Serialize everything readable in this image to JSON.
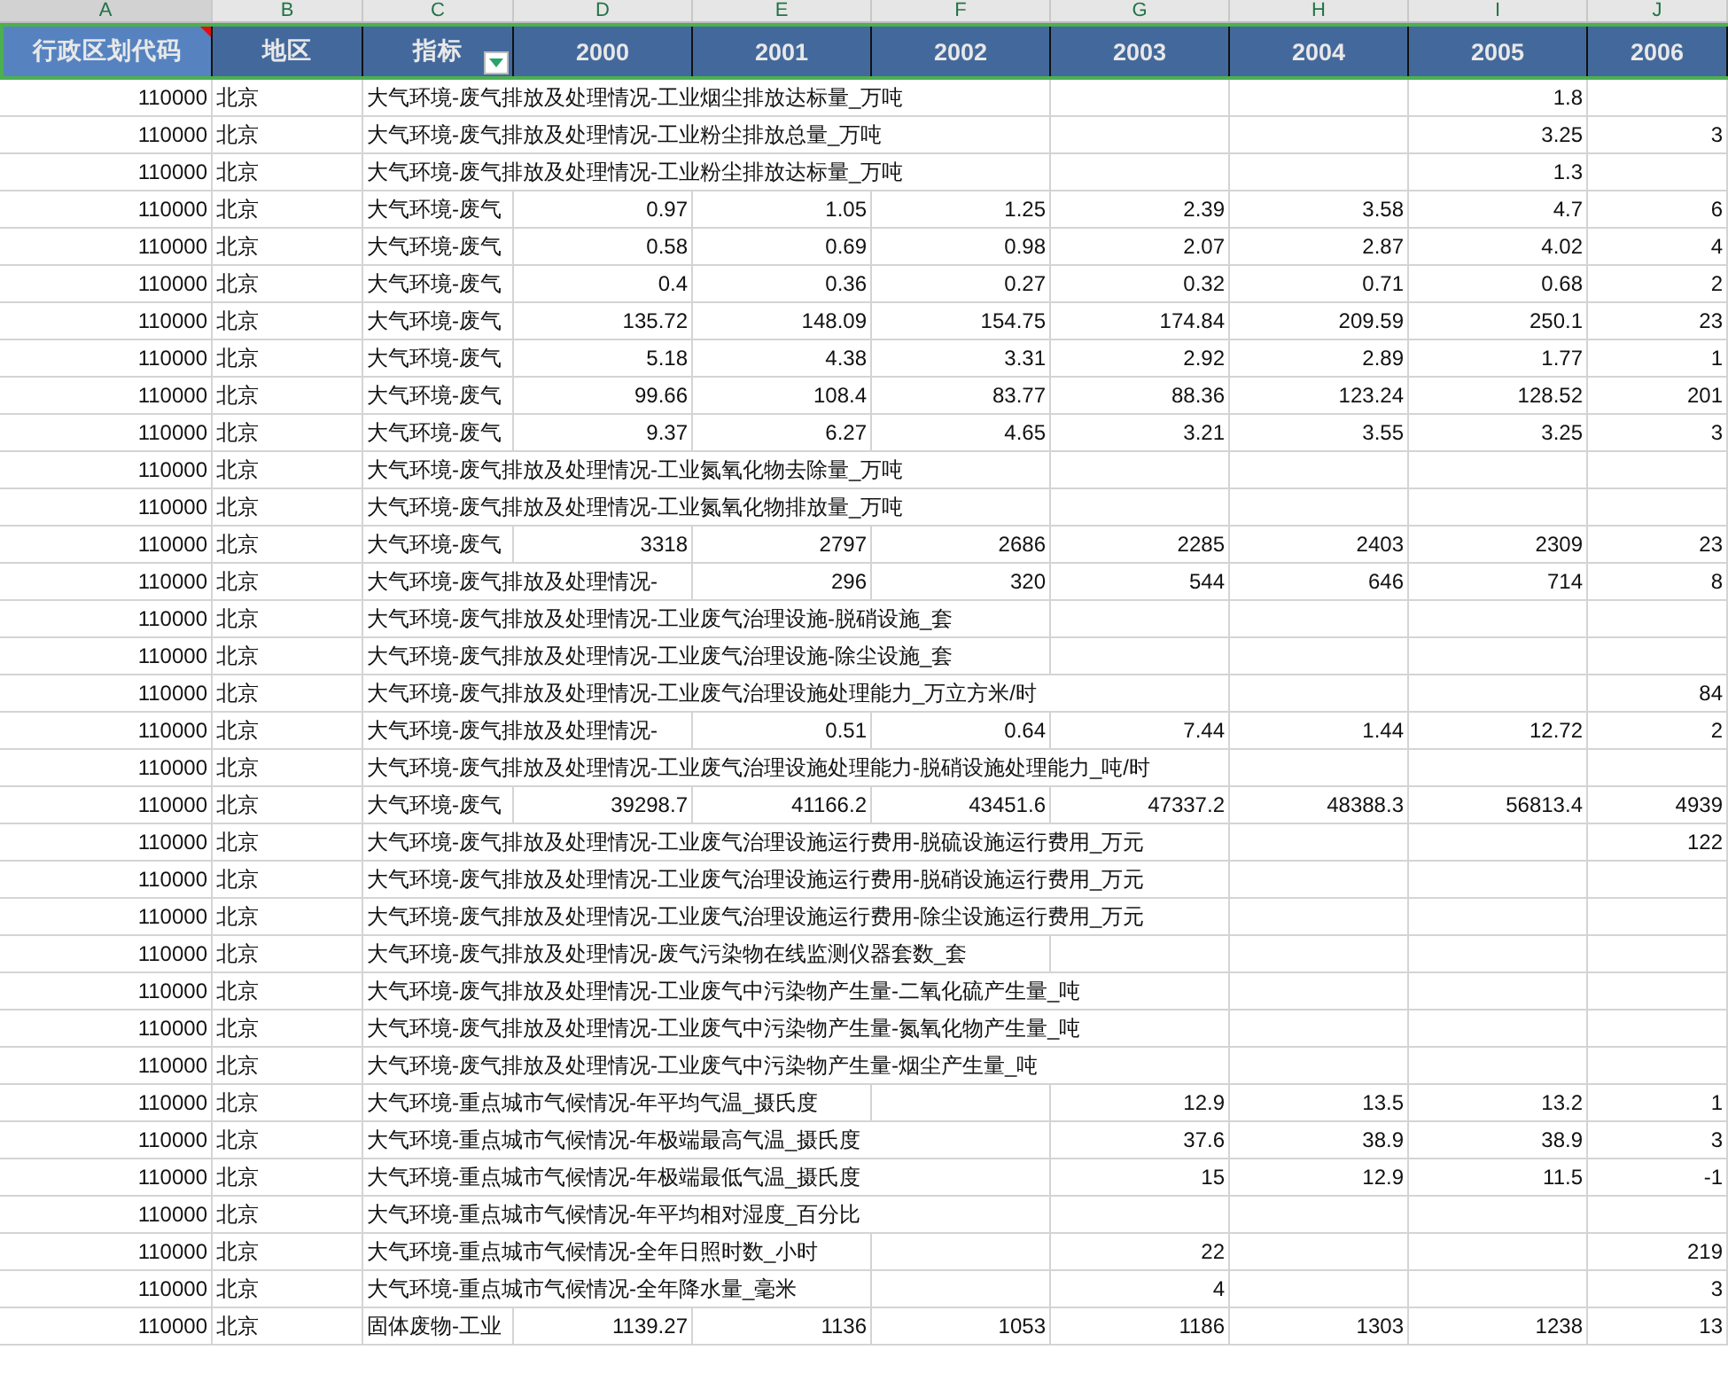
{
  "columns": [
    {
      "letter": "A",
      "heading": "行政区划代码",
      "selected": true,
      "filter": false,
      "comment": true
    },
    {
      "letter": "B",
      "heading": "地区",
      "selected": false,
      "filter": false,
      "comment": false
    },
    {
      "letter": "C",
      "heading": "指标",
      "selected": false,
      "filter": true,
      "comment": false
    },
    {
      "letter": "D",
      "heading": "2000",
      "selected": false,
      "filter": false,
      "comment": false
    },
    {
      "letter": "E",
      "heading": "2001",
      "selected": false,
      "filter": false,
      "comment": false
    },
    {
      "letter": "F",
      "heading": "2002",
      "selected": false,
      "filter": false,
      "comment": false
    },
    {
      "letter": "G",
      "heading": "2003",
      "selected": false,
      "filter": false,
      "comment": false
    },
    {
      "letter": "H",
      "heading": "2004",
      "selected": false,
      "filter": false,
      "comment": false
    },
    {
      "letter": "I",
      "heading": "2005",
      "selected": false,
      "filter": false,
      "comment": false
    },
    {
      "letter": "J",
      "heading": "2006",
      "selected": false,
      "filter": false,
      "comment": false
    }
  ],
  "rows": [
    {
      "code": "110000",
      "region": "北京",
      "indicator": "大气环境-废气排放及处理情况-工业烟尘排放达标量_万吨",
      "values": {
        "I": "1.8"
      }
    },
    {
      "code": "110000",
      "region": "北京",
      "indicator": "大气环境-废气排放及处理情况-工业粉尘排放总量_万吨",
      "values": {
        "I": "3.25",
        "J": "3"
      }
    },
    {
      "code": "110000",
      "region": "北京",
      "indicator": "大气环境-废气排放及处理情况-工业粉尘排放达标量_万吨",
      "values": {
        "I": "1.3"
      }
    },
    {
      "code": "110000",
      "region": "北京",
      "indicator": "大气环境-废气",
      "values": {
        "D": "0.97",
        "E": "1.05",
        "F": "1.25",
        "G": "2.39",
        "H": "3.58",
        "I": "4.7",
        "J": "6"
      }
    },
    {
      "code": "110000",
      "region": "北京",
      "indicator": "大气环境-废气",
      "values": {
        "D": "0.58",
        "E": "0.69",
        "F": "0.98",
        "G": "2.07",
        "H": "2.87",
        "I": "4.02",
        "J": "4"
      }
    },
    {
      "code": "110000",
      "region": "北京",
      "indicator": "大气环境-废气",
      "values": {
        "D": "0.4",
        "E": "0.36",
        "F": "0.27",
        "G": "0.32",
        "H": "0.71",
        "I": "0.68",
        "J": "2"
      }
    },
    {
      "code": "110000",
      "region": "北京",
      "indicator": "大气环境-废气",
      "values": {
        "D": "135.72",
        "E": "148.09",
        "F": "154.75",
        "G": "174.84",
        "H": "209.59",
        "I": "250.1",
        "J": "23"
      }
    },
    {
      "code": "110000",
      "region": "北京",
      "indicator": "大气环境-废气",
      "values": {
        "D": "5.18",
        "E": "4.38",
        "F": "3.31",
        "G": "2.92",
        "H": "2.89",
        "I": "1.77",
        "J": "1"
      }
    },
    {
      "code": "110000",
      "region": "北京",
      "indicator": "大气环境-废气",
      "values": {
        "D": "99.66",
        "E": "108.4",
        "F": "83.77",
        "G": "88.36",
        "H": "123.24",
        "I": "128.52",
        "J": "201"
      }
    },
    {
      "code": "110000",
      "region": "北京",
      "indicator": "大气环境-废气",
      "values": {
        "D": "9.37",
        "E": "6.27",
        "F": "4.65",
        "G": "3.21",
        "H": "3.55",
        "I": "3.25",
        "J": "3"
      }
    },
    {
      "code": "110000",
      "region": "北京",
      "indicator": "大气环境-废气排放及处理情况-工业氮氧化物去除量_万吨"
    },
    {
      "code": "110000",
      "region": "北京",
      "indicator": "大气环境-废气排放及处理情况-工业氮氧化物排放量_万吨"
    },
    {
      "code": "110000",
      "region": "北京",
      "indicator": "大气环境-废气",
      "values": {
        "D": "3318",
        "E": "2797",
        "F": "2686",
        "G": "2285",
        "H": "2403",
        "I": "2309",
        "J": "23"
      }
    },
    {
      "code": "110000",
      "region": "北京",
      "indicator": "大气环境-废气排放及处理情况-",
      "values": {
        "E": "296",
        "F": "320",
        "G": "544",
        "H": "646",
        "I": "714",
        "J": "8"
      }
    },
    {
      "code": "110000",
      "region": "北京",
      "indicator": "大气环境-废气排放及处理情况-工业废气治理设施-脱硝设施_套"
    },
    {
      "code": "110000",
      "region": "北京",
      "indicator": "大气环境-废气排放及处理情况-工业废气治理设施-除尘设施_套"
    },
    {
      "code": "110000",
      "region": "北京",
      "indicator": "大气环境-废气排放及处理情况-工业废气治理设施处理能力_万立方米/时",
      "values": {
        "J": "84"
      }
    },
    {
      "code": "110000",
      "region": "北京",
      "indicator": "大气环境-废气排放及处理情况-",
      "values": {
        "E": "0.51",
        "F": "0.64",
        "G": "7.44",
        "H": "1.44",
        "I": "12.72",
        "J": "2"
      }
    },
    {
      "code": "110000",
      "region": "北京",
      "indicator": "大气环境-废气排放及处理情况-工业废气治理设施处理能力-脱硝设施处理能力_吨/时"
    },
    {
      "code": "110000",
      "region": "北京",
      "indicator": "大气环境-废气",
      "values": {
        "D": "39298.7",
        "E": "41166.2",
        "F": "43451.6",
        "G": "47337.2",
        "H": "48388.3",
        "I": "56813.4",
        "J": "4939"
      }
    },
    {
      "code": "110000",
      "region": "北京",
      "indicator": "大气环境-废气排放及处理情况-工业废气治理设施运行费用-脱硫设施运行费用_万元",
      "values": {
        "J": "122"
      }
    },
    {
      "code": "110000",
      "region": "北京",
      "indicator": "大气环境-废气排放及处理情况-工业废气治理设施运行费用-脱硝设施运行费用_万元"
    },
    {
      "code": "110000",
      "region": "北京",
      "indicator": "大气环境-废气排放及处理情况-工业废气治理设施运行费用-除尘设施运行费用_万元"
    },
    {
      "code": "110000",
      "region": "北京",
      "indicator": "大气环境-废气排放及处理情况-废气污染物在线监测仪器套数_套"
    },
    {
      "code": "110000",
      "region": "北京",
      "indicator": "大气环境-废气排放及处理情况-工业废气中污染物产生量-二氧化硫产生量_吨"
    },
    {
      "code": "110000",
      "region": "北京",
      "indicator": "大气环境-废气排放及处理情况-工业废气中污染物产生量-氮氧化物产生量_吨"
    },
    {
      "code": "110000",
      "region": "北京",
      "indicator": "大气环境-废气排放及处理情况-工业废气中污染物产生量-烟尘产生量_吨"
    },
    {
      "code": "110000",
      "region": "北京",
      "indicator": "大气环境-重点城市气候情况-年平均气温_摄氏度",
      "values": {
        "G": "12.9",
        "H": "13.5",
        "I": "13.2",
        "J": "1"
      }
    },
    {
      "code": "110000",
      "region": "北京",
      "indicator": "大气环境-重点城市气候情况-年极端最高气温_摄氏度",
      "values": {
        "G": "37.6",
        "H": "38.9",
        "I": "38.9",
        "J": "3"
      }
    },
    {
      "code": "110000",
      "region": "北京",
      "indicator": "大气环境-重点城市气候情况-年极端最低气温_摄氏度",
      "values": {
        "G": "15",
        "H": "12.9",
        "I": "11.5",
        "J": "-1"
      }
    },
    {
      "code": "110000",
      "region": "北京",
      "indicator": "大气环境-重点城市气候情况-年平均相对湿度_百分比"
    },
    {
      "code": "110000",
      "region": "北京",
      "indicator": "大气环境-重点城市气候情况-全年日照时数_小时",
      "values": {
        "G": "22",
        "J": "219"
      }
    },
    {
      "code": "110000",
      "region": "北京",
      "indicator": "大气环境-重点城市气候情况-全年降水量_毫米",
      "values": {
        "G": "4",
        "J": "3"
      }
    },
    {
      "code": "110000",
      "region": "北京",
      "indicator": "固体废物-工业",
      "values": {
        "D": "1139.27",
        "E": "1136",
        "F": "1053",
        "G": "1186",
        "H": "1303",
        "I": "1238",
        "J": "13"
      }
    }
  ]
}
